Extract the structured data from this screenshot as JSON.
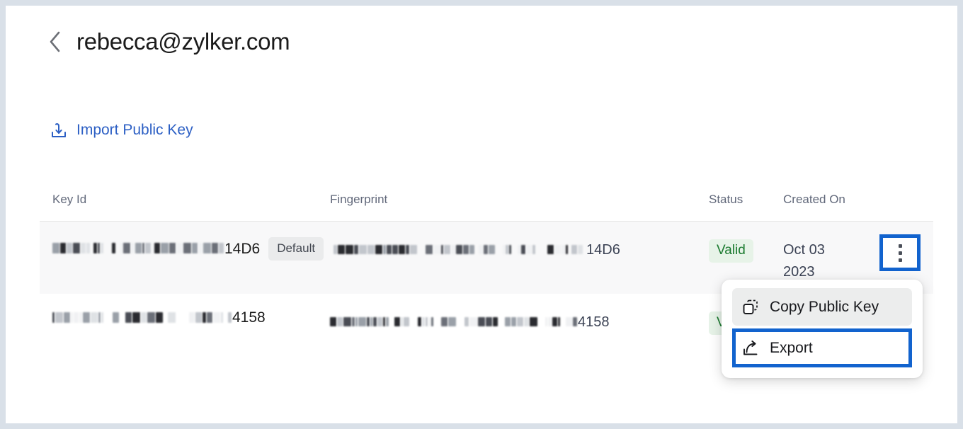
{
  "window": {
    "frame_color": "#d9e0e8",
    "background": "#ffffff"
  },
  "header": {
    "back_icon": "chevron-left-icon",
    "title": "rebecca@zylker.com"
  },
  "actions": {
    "import_icon": "import-key-icon",
    "import_label": "Import Public Key",
    "link_color": "#2c5fc4"
  },
  "table": {
    "columns": [
      {
        "key": "key_id",
        "label": "Key Id"
      },
      {
        "key": "fingerprint",
        "label": "Fingerprint"
      },
      {
        "key": "status",
        "label": "Status"
      },
      {
        "key": "created_on",
        "label": "Created On"
      }
    ],
    "rows": [
      {
        "key_id_redacted": true,
        "key_id_suffix": "14D6",
        "badge": "Default",
        "fingerprint_redacted": true,
        "fingerprint_suffix": "14D6",
        "status": "Valid",
        "status_color": "#1b7a2f",
        "status_background": "#e7f3e8",
        "created_on_line1": "Oct 03",
        "created_on_line2": "2023",
        "hovered": true,
        "actions_icon": "kebab-menu-icon",
        "actions_focused": true
      },
      {
        "key_id_redacted": true,
        "key_id_suffix": "4158",
        "badge": "",
        "fingerprint_redacted": true,
        "fingerprint_suffix": "4158",
        "status": "Valid",
        "status_color": "#1b7a2f",
        "status_background": "#e7f3e8",
        "created_on_line1": "",
        "created_on_line2": "",
        "hovered": false,
        "actions_icon": "kebab-menu-icon",
        "actions_focused": false
      }
    ]
  },
  "dropdown": {
    "visible": true,
    "items": [
      {
        "label": "Copy Public Key",
        "icon": "copy-icon",
        "hovered": true,
        "focused": false
      },
      {
        "label": "Export",
        "icon": "export-icon",
        "hovered": false,
        "focused": true
      }
    ]
  },
  "highlight": {
    "color": "#1263ce"
  }
}
